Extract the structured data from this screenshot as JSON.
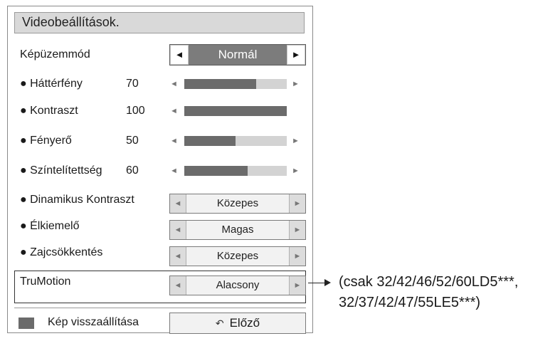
{
  "menu": {
    "title": "Videobeállítások.",
    "picture_mode": {
      "label": "Képüzemmód",
      "value": "Normál"
    },
    "sliders": [
      {
        "label": "● Háttérfény",
        "value": "70",
        "level": 0.7,
        "right_arrow": true
      },
      {
        "label": "● Kontraszt",
        "value": "100",
        "level": 1.0,
        "right_arrow": false
      },
      {
        "label": "● Fényerő",
        "value": "50",
        "level": 0.5,
        "right_arrow": true
      },
      {
        "label": "● Színtelítettség",
        "value": "60",
        "level": 0.62,
        "right_arrow": true
      }
    ],
    "selects": [
      {
        "label": "● Dinamikus Kontraszt",
        "value": "Közepes"
      },
      {
        "label": "● Élkiemelő",
        "value": "Magas"
      },
      {
        "label": "● Zajcsökkentés",
        "value": "Közepes"
      }
    ],
    "trumotion": {
      "label": "TruMotion",
      "value": "Alacsony"
    },
    "reset_label": "Kép visszaállítása",
    "previous_label": "Előző",
    "arrow_left": "◄",
    "arrow_right": "►"
  },
  "note": {
    "line1": "(csak 32/42/46/52/60LD5***,",
    "line2": "32/37/42/47/55LE5***)"
  },
  "colors": {
    "fill": "#6b6b6b",
    "track": "#d3d3d3",
    "highlight": "#7c7c7c"
  }
}
